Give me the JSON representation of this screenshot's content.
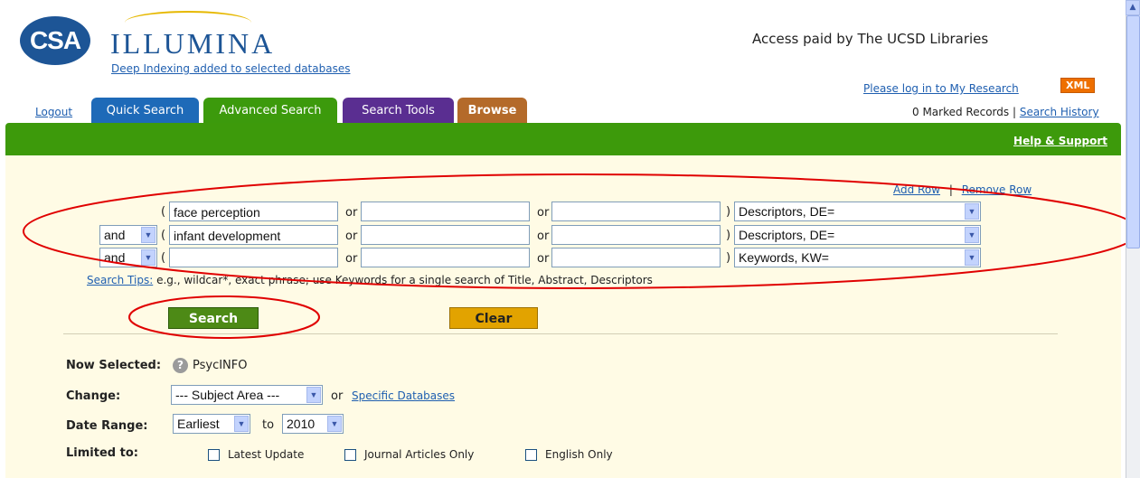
{
  "header": {
    "logo_text": "CSA",
    "brand": "ILLUMINA",
    "deep_link": "Deep Indexing added to selected databases",
    "access": "Access paid by The UCSD Libraries",
    "login_link": "Please log in to My Research",
    "xml_badge": "XML",
    "marked": "0 Marked Records |",
    "history_link": "Search History"
  },
  "tabs": {
    "logout": "Logout",
    "quick": "Quick Search",
    "advanced": "Advanced Search",
    "tools": "Search Tools",
    "browse": "Browse"
  },
  "help_link": "Help & Support",
  "row_controls": {
    "add": "Add Row",
    "sep": "|",
    "remove": "Remove Row"
  },
  "rows": [
    {
      "bool": "",
      "open": "(",
      "term1": "face perception",
      "or1": "or",
      "term2": "",
      "or2": "or",
      "term3": "",
      "close": ")",
      "field": "Descriptors, DE="
    },
    {
      "bool": "and",
      "open": "(",
      "term1": "infant development",
      "or1": "or",
      "term2": "",
      "or2": "or",
      "term3": "",
      "close": ")",
      "field": "Descriptors, DE="
    },
    {
      "bool": "and",
      "open": "(",
      "term1": "",
      "or1": "or",
      "term2": "",
      "or2": "or",
      "term3": "",
      "close": ")",
      "field": "Keywords, KW="
    }
  ],
  "tips": {
    "link": "Search Tips:",
    "text": "e.g., wildcar*, exact phrase; use Keywords for a single search of Title, Abstract, Descriptors"
  },
  "buttons": {
    "search": "Search",
    "clear": "Clear"
  },
  "now_selected": {
    "label": "Now Selected:",
    "value": "PsycINFO"
  },
  "change": {
    "label": "Change:",
    "select": "--- Subject Area ---",
    "or": "or",
    "link": "Specific Databases"
  },
  "date_range": {
    "label": "Date Range:",
    "from": "Earliest",
    "to_text": "to",
    "to": "2010"
  },
  "limited": {
    "label": "Limited to:",
    "options": [
      "Latest Update",
      "Journal Articles Only",
      "English Only"
    ]
  },
  "icons": {
    "dropdown": "chevron-down-icon",
    "help": "question-icon",
    "scroll_up": "arrow-up-icon"
  },
  "colors": {
    "advanced_tab": "#3c9a0c",
    "quick_tab": "#1e6ab8",
    "tools_tab": "#5a2e91",
    "browse_tab": "#b46a2a",
    "annotation": "#e00000"
  }
}
